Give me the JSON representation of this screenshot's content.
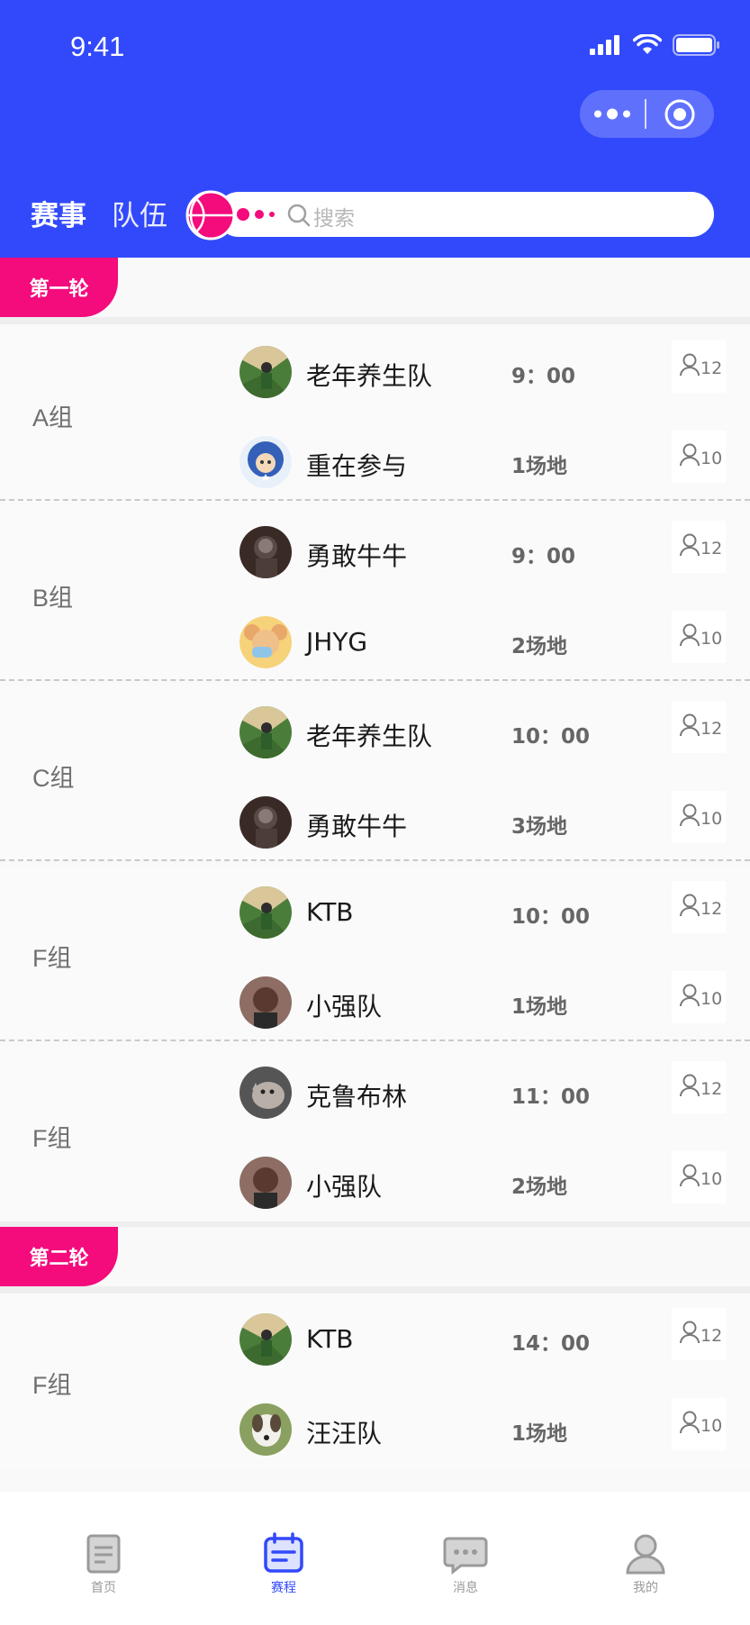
{
  "status": {
    "time": "9:41"
  },
  "colors": {
    "brand": "#3249fb",
    "accent": "#f40b7c"
  },
  "nav": {
    "tab_active": "赛事",
    "tab_inactive": "队伍",
    "search_placeholder": "搜索"
  },
  "rounds": [
    {
      "title": "第一轮"
    },
    {
      "title": "第二轮"
    }
  ],
  "groups": [
    {
      "label": "A组",
      "top": {
        "name": "老年养生队",
        "info": "9：00",
        "count": "12",
        "avatar": "court-green"
      },
      "bottom": {
        "name": "重在参与",
        "info": "1场地",
        "count": "10",
        "avatar": "captain-cartoon"
      }
    },
    {
      "label": "B组",
      "top": {
        "name": "勇敢牛牛",
        "info": "9：00",
        "count": "12",
        "avatar": "dark-portrait"
      },
      "bottom": {
        "name": "JHYG",
        "info": "2场地",
        "count": "10",
        "avatar": "mouse-cartoon"
      }
    },
    {
      "label": "C组",
      "top": {
        "name": "老年养生队",
        "info": "10：00",
        "count": "12",
        "avatar": "court-green"
      },
      "bottom": {
        "name": "勇敢牛牛",
        "info": "3场地",
        "count": "10",
        "avatar": "dark-portrait"
      }
    },
    {
      "label": "F组",
      "top": {
        "name": "KTB",
        "info": "10：00",
        "count": "12",
        "avatar": "court-green"
      },
      "bottom": {
        "name": "小强队",
        "info": "1场地",
        "count": "10",
        "avatar": "man-portrait"
      }
    },
    {
      "label": "F组",
      "top": {
        "name": "克鲁布林",
        "info": "11：00",
        "count": "12",
        "avatar": "cat-photo"
      },
      "bottom": {
        "name": "小强队",
        "info": "2场地",
        "count": "10",
        "avatar": "man-portrait"
      }
    },
    {
      "label": "F组",
      "top": {
        "name": "KTB",
        "info": "14：00",
        "count": "12",
        "avatar": "court-green"
      },
      "bottom": {
        "name": "汪汪队",
        "info": "1场地",
        "count": "10",
        "avatar": "dog-photo"
      }
    }
  ],
  "tabbar": {
    "items": [
      {
        "label": "首页",
        "icon": "document-icon",
        "active": false
      },
      {
        "label": "赛程",
        "icon": "calendar-icon",
        "active": true
      },
      {
        "label": "消息",
        "icon": "message-icon",
        "active": false
      },
      {
        "label": "我的",
        "icon": "user-icon",
        "active": false
      }
    ]
  }
}
